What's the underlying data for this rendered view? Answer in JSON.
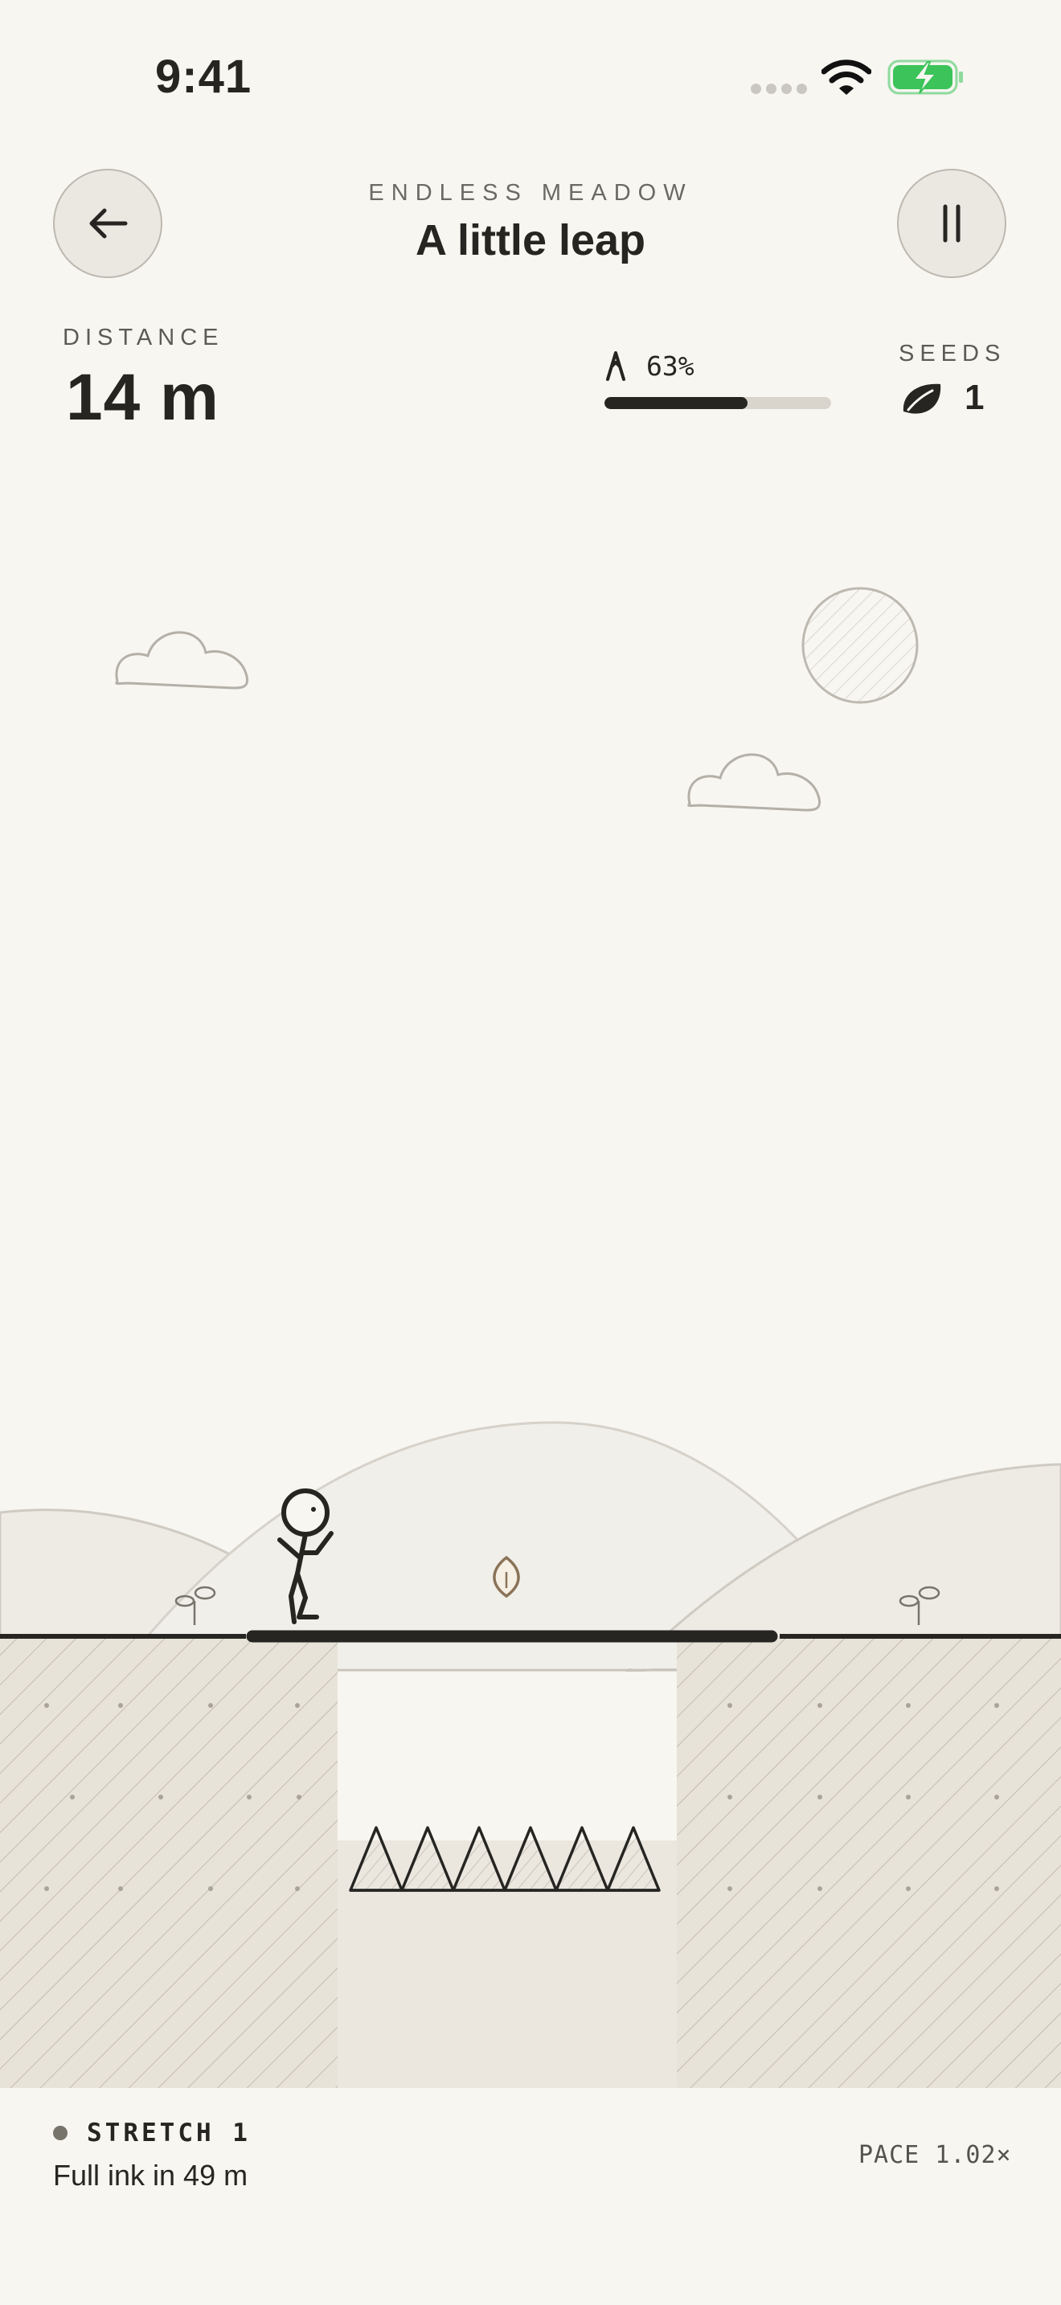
{
  "status_bar": {
    "time": "9:41",
    "battery_color": "#3cc35a"
  },
  "header": {
    "subtitle": "ENDLESS MEADOW",
    "title": "A little leap",
    "back_icon": "arrow-left-icon",
    "pause_icon": "pause-icon"
  },
  "stats": {
    "distance_label": "DISTANCE",
    "distance_value": "14 m",
    "ink_icon": "pen-nib-icon",
    "ink_percent_text": "63%",
    "ink_fraction": 0.63,
    "seeds_label": "SEEDS",
    "seeds_icon": "leaf-icon",
    "seeds_count": "1"
  },
  "footer": {
    "stretch_label": "STRETCH 1",
    "stretch_sub": "Full ink in 49 m",
    "pace": "PACE 1.02×"
  },
  "colors": {
    "background": "#f7f6f1",
    "ink": "#262522",
    "ground_fill": "#e8e3d9",
    "muted": "#76746b"
  }
}
